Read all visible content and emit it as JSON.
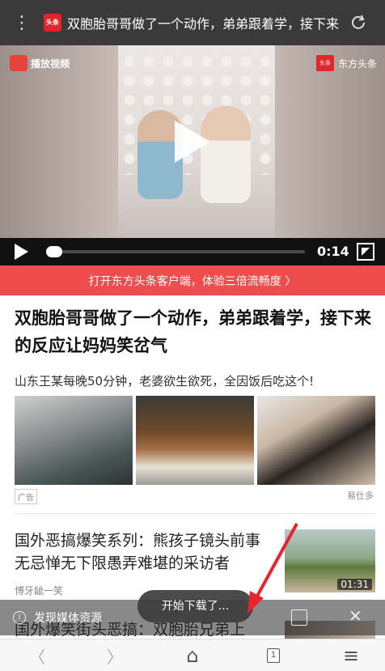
{
  "topbar": {
    "menu_glyph": "⋮",
    "favicon_text": "头条",
    "title": "双胞胎哥哥做了一个动作，弟弟跟着学，接下来"
  },
  "video": {
    "logo_left": "播放视频",
    "logo_right_mark": "头条",
    "logo_right": "东方头条",
    "time": "0:14",
    "progress": 0.03
  },
  "banner": {
    "text": "打开东方头条客户端，体验三倍流畅度 〉"
  },
  "article": {
    "headline": "双胞胎哥哥做了一个动作，弟弟跟着学，接下来的反应让妈妈笑岔气"
  },
  "ad": {
    "title": "山东王某每晚50分钟，老婆欲生欲死，全因饭后吃这个!",
    "tag": "广告",
    "source": "易仕多"
  },
  "news": [
    {
      "title": "国外恶搞爆笑系列：熊孩子镜头前事无忌惮无下限愚弄难堪的采访者",
      "source": "博牙龇一笑",
      "duration": "01:31"
    },
    {
      "title": "国外爆笑街头恶搞：双胞胎兄弟上"
    }
  ],
  "media_bar": {
    "label": "发现媒体资源"
  },
  "toast": {
    "text": "开始下载了..."
  },
  "navbar": {
    "back": "〈",
    "forward": "〉",
    "home": "⌂",
    "tabs_count": "1",
    "menu": "≡"
  },
  "colors": {
    "banner": "#ef4d4d",
    "arrow": "#e8232d",
    "topbar": "#3a3a3a"
  }
}
